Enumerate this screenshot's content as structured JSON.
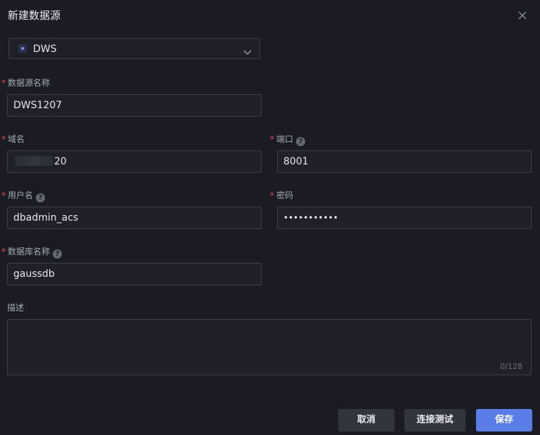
{
  "dialog": {
    "title": "新建数据源",
    "close_icon": "close-icon"
  },
  "datasource_type": {
    "icon": "database-icon",
    "value": "DWS",
    "chevron_icon": "chevron-down-icon"
  },
  "fields": {
    "name": {
      "required": "*",
      "label": "数据源名称",
      "value": "DWS1207"
    },
    "domain": {
      "required": "*",
      "label": "域名",
      "value_suffix": "20"
    },
    "port": {
      "required": "*",
      "label": "端口",
      "value": "8001"
    },
    "username": {
      "required": "*",
      "label": "用户名",
      "value": "dbadmin_acs"
    },
    "password": {
      "required": "*",
      "label": "密码",
      "value": "•••••••••••"
    },
    "database": {
      "required": "*",
      "label": "数据库名称",
      "value": "gaussdb"
    },
    "description": {
      "label": "描述",
      "counter": "0/128"
    }
  },
  "help_icon_glyph": "?",
  "buttons": {
    "cancel": "取消",
    "test": "连接测试",
    "save": "保存"
  },
  "colors": {
    "background": "#1b1c23",
    "primary": "#5b7de8",
    "required": "#e34d59"
  }
}
